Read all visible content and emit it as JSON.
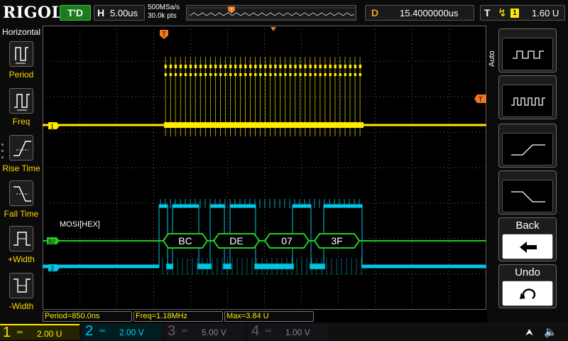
{
  "topbar": {
    "logo": "RIGOL",
    "status": "T'D",
    "timebase_label": "H",
    "timebase_value": "5.00us",
    "sample_rate": "500MSa/s",
    "memory_depth": "30.0k pts",
    "delay_label": "D",
    "delay_value": "15.4000000us",
    "trigger_label": "T",
    "trigger_edge_icon": "rising-edge-icon",
    "trigger_source": "1",
    "trigger_level": "1.60 U"
  },
  "left_menu": {
    "title": "Horizontal",
    "items": [
      {
        "label": "Period",
        "icon": "period-icon"
      },
      {
        "label": "Freq",
        "icon": "frequency-icon"
      },
      {
        "label": "Rise Time",
        "icon": "rise-time-icon"
      },
      {
        "label": "Fall Time",
        "icon": "fall-time-icon"
      },
      {
        "label": "+Width",
        "icon": "positive-width-icon"
      },
      {
        "label": "-Width",
        "icon": "negative-width-icon"
      }
    ]
  },
  "waveform": {
    "ch1_marker": "1",
    "ch2_marker": "2",
    "bus_marker": "B2",
    "bus_label": "MOSI[HEX]",
    "trigger_marker": "T",
    "level_marker": "T",
    "bus_values": [
      "BC",
      "DE",
      "07",
      "3F"
    ],
    "ch1_color": "#ffea00",
    "ch2_color": "#00c8e6",
    "bus_color": "#22cc22"
  },
  "right_menu": {
    "mode_label": "Auto",
    "buttons": [
      {
        "name": "period-waveform-key",
        "icon": "square-wave-icon"
      },
      {
        "name": "frequency-waveform-key",
        "icon": "fast-square-wave-icon"
      },
      {
        "name": "rise-edge-key",
        "icon": "rising-edge-icon"
      },
      {
        "name": "fall-edge-key",
        "icon": "falling-edge-icon"
      }
    ],
    "back_label": "Back",
    "back_icon": "arrow-left-icon",
    "undo_label": "Undo",
    "undo_icon": "undo-icon"
  },
  "measurements": {
    "period": "Period=850.0ns",
    "freq": "Freq=1.18MHz",
    "max": "Max=3.84 U"
  },
  "channels": [
    {
      "num": "1",
      "coupling": "═",
      "scale": "2.00 U",
      "color": "#ffea00",
      "active": true
    },
    {
      "num": "2",
      "coupling": "═",
      "scale": "2.00 V",
      "color": "#00c8e6",
      "active": true
    },
    {
      "num": "3",
      "coupling": "═",
      "scale": "5.00 V",
      "color": "#b040c0",
      "active": false
    },
    {
      "num": "4",
      "coupling": "═",
      "scale": "1.00 V",
      "color": "#3060ff",
      "active": false
    }
  ],
  "status_icons": {
    "usb": "usb-icon",
    "speaker": "speaker-muted-icon"
  }
}
